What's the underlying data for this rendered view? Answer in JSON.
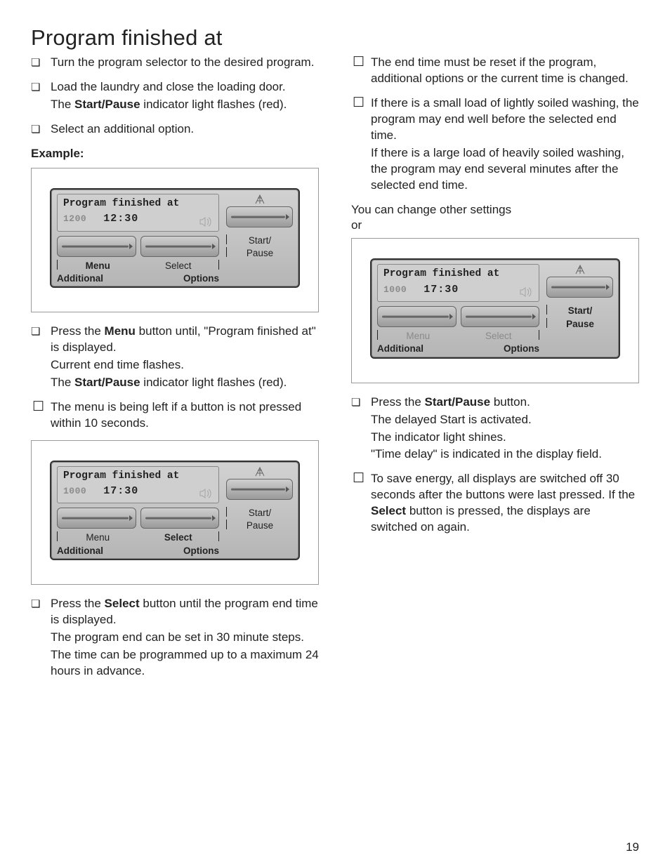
{
  "page_number": "19",
  "title": "Program finished at",
  "left": {
    "steps1": [
      {
        "t1": "Turn the program selector to the desired program."
      },
      {
        "t1": "Load the laundry and close the loading door.",
        "t2a": "The ",
        "t2b": "Start/Pause",
        "t2c": " indicator light flashes (red)."
      },
      {
        "t1": "Select an additional option."
      }
    ],
    "example_label": "Example:",
    "panel1": {
      "lcd_title": "Program finished at",
      "spin": "1200",
      "time": "12:30",
      "menu": "Menu",
      "select": "Select",
      "additional": "Additional",
      "options": "Options",
      "start": "Start/",
      "pause": "Pause",
      "menu_bold": true,
      "select_bold": false,
      "sp_bold": false
    },
    "step_menu": {
      "l1a": "Press the ",
      "l1b": "Menu",
      "l1c": " button until, \"Program finished at\" is displayed.",
      "l2": "Current end time flashes.",
      "l3a": "The ",
      "l3b": "Start/Pause",
      "l3c": " indicator light flashes (red)."
    },
    "note_10s": "The menu is being left if a button is not pressed within 10 seconds.",
    "panel2": {
      "lcd_title": "Program finished at",
      "spin": "1000",
      "time": "17:30",
      "menu": "Menu",
      "select": "Select",
      "additional": "Additional",
      "options": "Options",
      "start": "Start/",
      "pause": "Pause",
      "menu_bold": false,
      "select_bold": true,
      "sp_bold": false
    },
    "step_select": {
      "l1a": "Press the ",
      "l1b": "Select",
      "l1c": " button until the program end time is displayed.",
      "l2": "The program end can be set in 30 minute steps.",
      "l3": "The time can be programmed up to a maximum 24 hours in advance."
    }
  },
  "right": {
    "note_reset": "The end time must be reset if the program, additional options or the current time is changed.",
    "note_load_1": "If there is a small load of lightly soiled washing, the program may end well before the selected end time.",
    "note_load_2": "If there is a large load of heavily soiled washing, the program may end several minutes after the selected end time.",
    "change_line1": "You can change other settings",
    "change_line2": "or",
    "panel3": {
      "lcd_title": "Program finished at",
      "spin": "1000",
      "time": "17:30",
      "menu": "Menu",
      "select": "Select",
      "additional": "Additional",
      "options": "Options",
      "start": "Start/",
      "pause": "Pause",
      "menu_bold": false,
      "select_bold": false,
      "sp_bold": true,
      "dim_ms": true
    },
    "step_start": {
      "l1a": "Press the ",
      "l1b": "Start/Pause",
      "l1c": " button.",
      "l2": "The delayed Start is activated.",
      "l3": "The indicator light shines.",
      "l4": "\"Time delay\" is indicated in the display field."
    },
    "note_energy_a": "To save energy, all displays are switched off 30 seconds after the buttons were last pressed. If the ",
    "note_energy_b": "Select",
    "note_energy_c": " button is pressed, the displays are switched on again."
  }
}
